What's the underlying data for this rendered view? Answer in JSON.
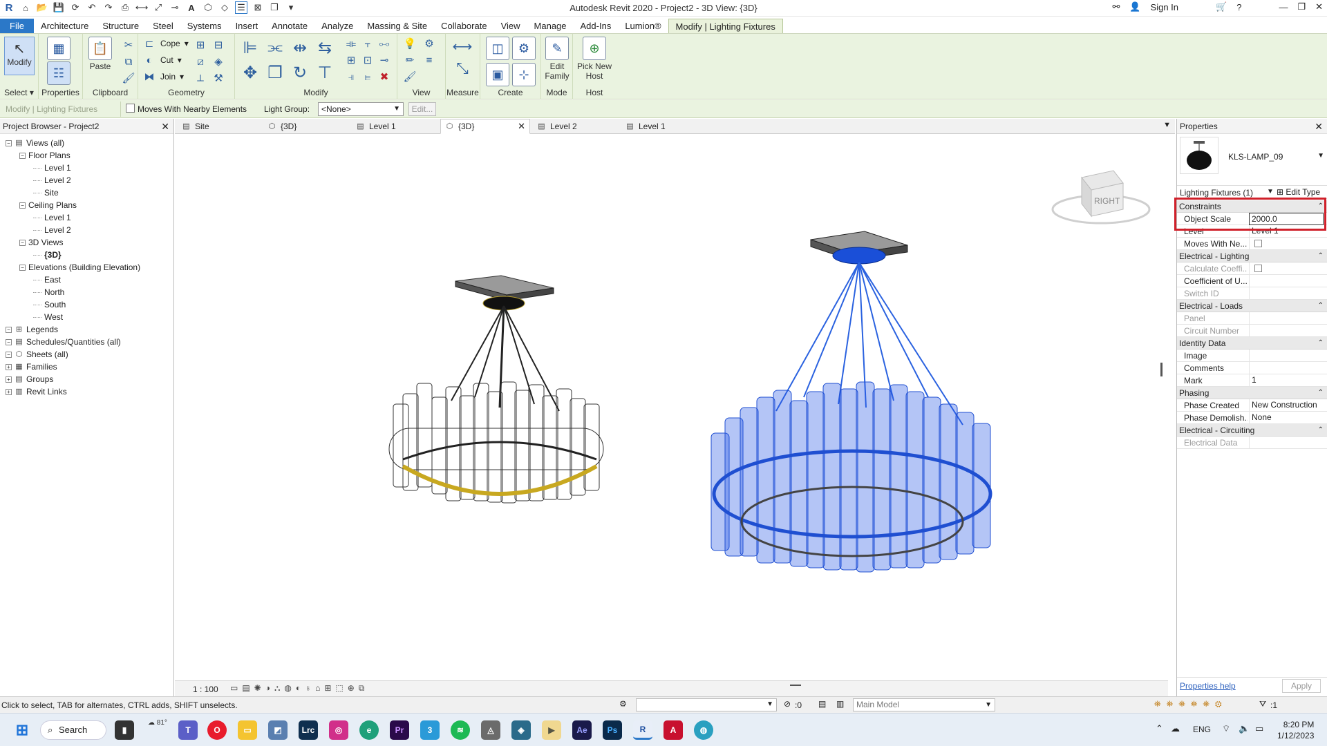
{
  "app": {
    "title": "Autodesk Revit 2020 - Project2 - 3D View: {3D}",
    "sign_in": "Sign In"
  },
  "menu": {
    "tabs": [
      "File",
      "Architecture",
      "Structure",
      "Steel",
      "Systems",
      "Insert",
      "Annotate",
      "Analyze",
      "Massing & Site",
      "Collaborate",
      "View",
      "Manage",
      "Add-Ins",
      "Lumion®",
      "Modify | Lighting Fixtures"
    ]
  },
  "ribbon": {
    "select": {
      "label": "Select",
      "modify": "Modify"
    },
    "properties": {
      "label": "Properties"
    },
    "clipboard": {
      "label": "Clipboard",
      "paste": "Paste"
    },
    "geometry": {
      "label": "Geometry",
      "cope": "Cope",
      "cut": "Cut",
      "join": "Join"
    },
    "modify": {
      "label": "Modify"
    },
    "view": {
      "label": "View"
    },
    "measure": {
      "label": "Measure"
    },
    "create": {
      "label": "Create"
    },
    "mode": {
      "label": "Mode",
      "edit_family": "Edit Family"
    },
    "host": {
      "label": "Host",
      "pick_new_host": "Pick New Host"
    }
  },
  "optbar": {
    "context": "Modify | Lighting Fixtures",
    "moves_with": "Moves With Nearby Elements",
    "light_group_label": "Light Group:",
    "light_group_value": "<None>",
    "edit": "Edit..."
  },
  "browser": {
    "title": "Project Browser - Project2",
    "items": [
      {
        "label": "Views (all)",
        "level": 0
      },
      {
        "label": "Floor Plans",
        "level": 1
      },
      {
        "label": "Level 1",
        "level": 2
      },
      {
        "label": "Level 2",
        "level": 2
      },
      {
        "label": "Site",
        "level": 2
      },
      {
        "label": "Ceiling Plans",
        "level": 1
      },
      {
        "label": "Level 1",
        "level": 2
      },
      {
        "label": "Level 2",
        "level": 2
      },
      {
        "label": "3D Views",
        "level": 1
      },
      {
        "label": "{3D}",
        "level": 2
      },
      {
        "label": "Elevations (Building Elevation)",
        "level": 1
      },
      {
        "label": "East",
        "level": 2
      },
      {
        "label": "North",
        "level": 2
      },
      {
        "label": "South",
        "level": 2
      },
      {
        "label": "West",
        "level": 2
      },
      {
        "label": "Legends",
        "level": 0
      },
      {
        "label": "Schedules/Quantities (all)",
        "level": 0
      },
      {
        "label": "Sheets (all)",
        "level": 0
      },
      {
        "label": "Families",
        "level": 0
      },
      {
        "label": "Groups",
        "level": 0
      },
      {
        "label": "Revit Links",
        "level": 0
      }
    ]
  },
  "viewtabs": [
    "Site",
    "{3D}",
    "Level 1",
    "{3D}",
    "Level 2",
    "Level 1"
  ],
  "viewcube": {
    "face": "RIGHT"
  },
  "viewctl": {
    "scale": "1 : 100"
  },
  "properties": {
    "title": "Properties",
    "family": "KLS-LAMP_09",
    "selector": "Lighting Fixtures (1)",
    "edit_type": "Edit Type",
    "sections": [
      {
        "name": "Constraints",
        "rows": [
          {
            "k": "Object Scale",
            "v": "2000.0",
            "editing": true
          },
          {
            "k": "Level",
            "v": "Level 1"
          },
          {
            "k": "Moves With Ne...",
            "v": "",
            "checkbox": true
          }
        ]
      },
      {
        "name": "Electrical - Lighting",
        "rows": [
          {
            "k": "Calculate Coeffi...",
            "v": "",
            "checkbox": true,
            "grey": true
          },
          {
            "k": "Coefficient of U...",
            "v": ""
          },
          {
            "k": "Switch ID",
            "v": "",
            "grey": true
          }
        ]
      },
      {
        "name": "Electrical - Loads",
        "rows": [
          {
            "k": "Panel",
            "v": "",
            "grey": true
          },
          {
            "k": "Circuit Number",
            "v": "",
            "grey": true
          }
        ]
      },
      {
        "name": "Identity Data",
        "rows": [
          {
            "k": "Image",
            "v": ""
          },
          {
            "k": "Comments",
            "v": ""
          },
          {
            "k": "Mark",
            "v": "1"
          }
        ]
      },
      {
        "name": "Phasing",
        "rows": [
          {
            "k": "Phase Created",
            "v": "New Construction"
          },
          {
            "k": "Phase Demolish...",
            "v": "None"
          }
        ]
      },
      {
        "name": "Electrical - Circuiting",
        "rows": [
          {
            "k": "Electrical Data",
            "v": "",
            "grey": true
          }
        ]
      }
    ],
    "help": "Properties help",
    "apply": "Apply"
  },
  "status": {
    "hint": "Click to select, TAB for alternates, CTRL adds, SHIFT unselects.",
    "count": ":0",
    "model": "Main Model",
    "filter": ":1"
  },
  "taskbar": {
    "search": "Search",
    "weather": "81°",
    "lang": "ENG",
    "time": "8:20 PM",
    "date": "1/12/2023"
  },
  "colors": {
    "ribbon": "#eaf3e0",
    "file_tab": "#2b78c8",
    "selection_blue": "#1f4fd1",
    "highlight_red": "#d0202a"
  }
}
